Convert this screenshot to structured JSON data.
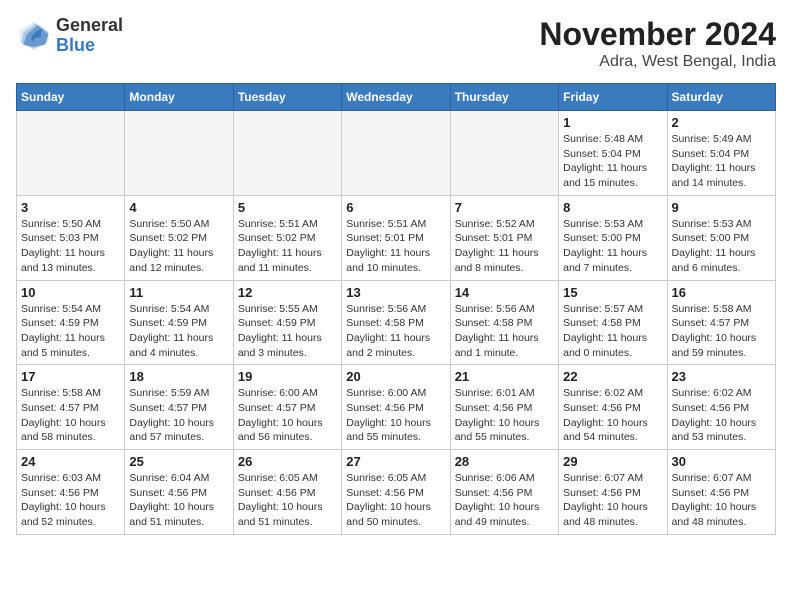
{
  "header": {
    "logo_general": "General",
    "logo_blue": "Blue",
    "month_title": "November 2024",
    "location": "Adra, West Bengal, India"
  },
  "weekdays": [
    "Sunday",
    "Monday",
    "Tuesday",
    "Wednesday",
    "Thursday",
    "Friday",
    "Saturday"
  ],
  "weeks": [
    [
      {
        "day": "",
        "info": ""
      },
      {
        "day": "",
        "info": ""
      },
      {
        "day": "",
        "info": ""
      },
      {
        "day": "",
        "info": ""
      },
      {
        "day": "",
        "info": ""
      },
      {
        "day": "1",
        "info": "Sunrise: 5:48 AM\nSunset: 5:04 PM\nDaylight: 11 hours and 15 minutes."
      },
      {
        "day": "2",
        "info": "Sunrise: 5:49 AM\nSunset: 5:04 PM\nDaylight: 11 hours and 14 minutes."
      }
    ],
    [
      {
        "day": "3",
        "info": "Sunrise: 5:50 AM\nSunset: 5:03 PM\nDaylight: 11 hours and 13 minutes."
      },
      {
        "day": "4",
        "info": "Sunrise: 5:50 AM\nSunset: 5:02 PM\nDaylight: 11 hours and 12 minutes."
      },
      {
        "day": "5",
        "info": "Sunrise: 5:51 AM\nSunset: 5:02 PM\nDaylight: 11 hours and 11 minutes."
      },
      {
        "day": "6",
        "info": "Sunrise: 5:51 AM\nSunset: 5:01 PM\nDaylight: 11 hours and 10 minutes."
      },
      {
        "day": "7",
        "info": "Sunrise: 5:52 AM\nSunset: 5:01 PM\nDaylight: 11 hours and 8 minutes."
      },
      {
        "day": "8",
        "info": "Sunrise: 5:53 AM\nSunset: 5:00 PM\nDaylight: 11 hours and 7 minutes."
      },
      {
        "day": "9",
        "info": "Sunrise: 5:53 AM\nSunset: 5:00 PM\nDaylight: 11 hours and 6 minutes."
      }
    ],
    [
      {
        "day": "10",
        "info": "Sunrise: 5:54 AM\nSunset: 4:59 PM\nDaylight: 11 hours and 5 minutes."
      },
      {
        "day": "11",
        "info": "Sunrise: 5:54 AM\nSunset: 4:59 PM\nDaylight: 11 hours and 4 minutes."
      },
      {
        "day": "12",
        "info": "Sunrise: 5:55 AM\nSunset: 4:59 PM\nDaylight: 11 hours and 3 minutes."
      },
      {
        "day": "13",
        "info": "Sunrise: 5:56 AM\nSunset: 4:58 PM\nDaylight: 11 hours and 2 minutes."
      },
      {
        "day": "14",
        "info": "Sunrise: 5:56 AM\nSunset: 4:58 PM\nDaylight: 11 hours and 1 minute."
      },
      {
        "day": "15",
        "info": "Sunrise: 5:57 AM\nSunset: 4:58 PM\nDaylight: 11 hours and 0 minutes."
      },
      {
        "day": "16",
        "info": "Sunrise: 5:58 AM\nSunset: 4:57 PM\nDaylight: 10 hours and 59 minutes."
      }
    ],
    [
      {
        "day": "17",
        "info": "Sunrise: 5:58 AM\nSunset: 4:57 PM\nDaylight: 10 hours and 58 minutes."
      },
      {
        "day": "18",
        "info": "Sunrise: 5:59 AM\nSunset: 4:57 PM\nDaylight: 10 hours and 57 minutes."
      },
      {
        "day": "19",
        "info": "Sunrise: 6:00 AM\nSunset: 4:57 PM\nDaylight: 10 hours and 56 minutes."
      },
      {
        "day": "20",
        "info": "Sunrise: 6:00 AM\nSunset: 4:56 PM\nDaylight: 10 hours and 55 minutes."
      },
      {
        "day": "21",
        "info": "Sunrise: 6:01 AM\nSunset: 4:56 PM\nDaylight: 10 hours and 55 minutes."
      },
      {
        "day": "22",
        "info": "Sunrise: 6:02 AM\nSunset: 4:56 PM\nDaylight: 10 hours and 54 minutes."
      },
      {
        "day": "23",
        "info": "Sunrise: 6:02 AM\nSunset: 4:56 PM\nDaylight: 10 hours and 53 minutes."
      }
    ],
    [
      {
        "day": "24",
        "info": "Sunrise: 6:03 AM\nSunset: 4:56 PM\nDaylight: 10 hours and 52 minutes."
      },
      {
        "day": "25",
        "info": "Sunrise: 6:04 AM\nSunset: 4:56 PM\nDaylight: 10 hours and 51 minutes."
      },
      {
        "day": "26",
        "info": "Sunrise: 6:05 AM\nSunset: 4:56 PM\nDaylight: 10 hours and 51 minutes."
      },
      {
        "day": "27",
        "info": "Sunrise: 6:05 AM\nSunset: 4:56 PM\nDaylight: 10 hours and 50 minutes."
      },
      {
        "day": "28",
        "info": "Sunrise: 6:06 AM\nSunset: 4:56 PM\nDaylight: 10 hours and 49 minutes."
      },
      {
        "day": "29",
        "info": "Sunrise: 6:07 AM\nSunset: 4:56 PM\nDaylight: 10 hours and 48 minutes."
      },
      {
        "day": "30",
        "info": "Sunrise: 6:07 AM\nSunset: 4:56 PM\nDaylight: 10 hours and 48 minutes."
      }
    ]
  ]
}
